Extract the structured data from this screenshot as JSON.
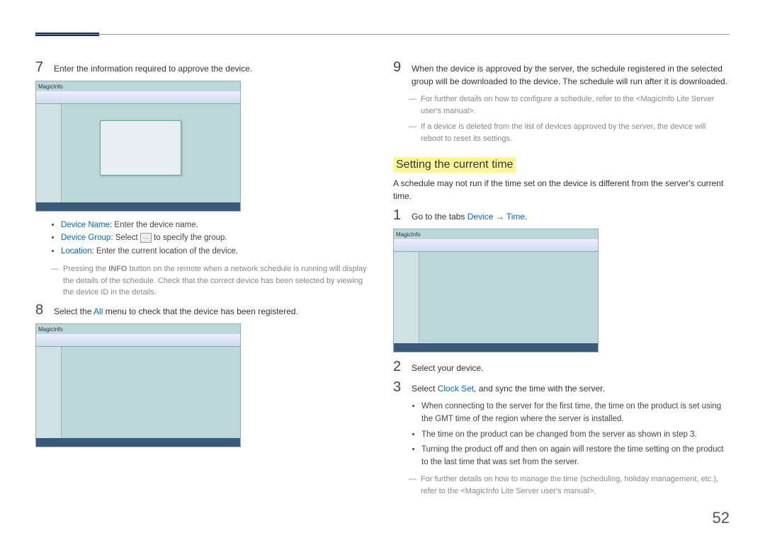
{
  "pageNumber": "52",
  "heading": "Setting the current time",
  "left": {
    "step7": {
      "num": "7",
      "text": "Enter the information required to approve the device."
    },
    "img1_logo": "MagicInfo",
    "bullets": {
      "deviceName_label": "Device Name",
      "deviceName_text": ": Enter the device name.",
      "deviceGroup_label": "Device Group",
      "deviceGroup_text_a": ": Select ",
      "deviceGroup_text_b": " to specify the group.",
      "location_label": "Location",
      "location_text": ": Enter the current location of the device."
    },
    "note1_a": "Pressing the ",
    "note1_b": "INFO",
    "note1_c": " button on the remote when a network schedule is running will display the details of the schedule. Check that the correct device has been selected by viewing the device ID in the details.",
    "step8": {
      "num": "8",
      "text_a": "Select the ",
      "text_b": "All",
      "text_c": " menu to check that the device has been registered."
    },
    "img2_logo": "MagicInfo"
  },
  "right": {
    "step9": {
      "num": "9",
      "text": "When the device is approved by the server, the schedule registered in the selected group will be downloaded to the device. The schedule will run after it is downloaded."
    },
    "note_a": "For further details on how to configure a schedule, refer to the <MagicInfo Lite Server user's manual>.",
    "note_b": "If a device is deleted from the list of devices approved by the server, the device will reboot to reset its settings.",
    "intro": "A schedule may not run if the time set on the device is different from the server's current time.",
    "step1": {
      "num": "1",
      "a": "Go to the tabs ",
      "b": "Device",
      "c": " → ",
      "d": "Time",
      "e": "."
    },
    "img_logo": "MagicInfo",
    "step2": {
      "num": "2",
      "text": "Select your device."
    },
    "step3": {
      "num": "3",
      "a": "Select ",
      "b": "Clock Set",
      "c": ", and sync the time with the server."
    },
    "sub": {
      "b1": "When connecting to the server for the first time, the time on the product is set using the GMT time of the region where the server is installed.",
      "b2": "The time on the product can be changed from the server as shown in step 3.",
      "b3": "Turning the product off and then on again will restore the time setting on the product to the last time that was set from the server."
    },
    "note_last": "For further details on how to manage the time (scheduling, holiday management, etc.), refer to the <MagicInfo Lite Server user's manual>."
  }
}
